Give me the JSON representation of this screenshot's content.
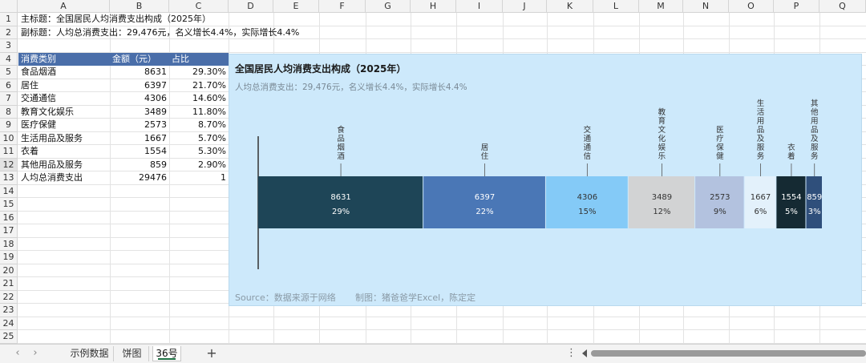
{
  "columns": [
    "A",
    "B",
    "C",
    "D",
    "E",
    "F",
    "G",
    "H",
    "I",
    "J",
    "K",
    "L",
    "M",
    "N",
    "O",
    "P",
    "Q"
  ],
  "rows": [
    "1",
    "2",
    "3",
    "4",
    "5",
    "6",
    "7",
    "8",
    "9",
    "10",
    "11",
    "12",
    "13",
    "14",
    "15",
    "16",
    "17",
    "18",
    "19",
    "20",
    "21",
    "22",
    "23",
    "24",
    "25"
  ],
  "selected_row": "12",
  "cells": {
    "a1": "主标题：全国居民人均消费支出构成（2025年）",
    "a2": "副标题：人均总消费支出：29,476元，名义增长4.4%，实际增长4.4%",
    "header": {
      "category": "消费类别",
      "amount": "金额（元）",
      "share": "占比"
    },
    "table": [
      {
        "category": "食品烟酒",
        "amount": "8631",
        "share": "29.30%"
      },
      {
        "category": "居住",
        "amount": "6397",
        "share": "21.70%"
      },
      {
        "category": "交通通信",
        "amount": "4306",
        "share": "14.60%"
      },
      {
        "category": "教育文化娱乐",
        "amount": "3489",
        "share": "11.80%"
      },
      {
        "category": "医疗保健",
        "amount": "2573",
        "share": "8.70%"
      },
      {
        "category": "生活用品及服务",
        "amount": "1667",
        "share": "5.70%"
      },
      {
        "category": "衣着",
        "amount": "1554",
        "share": "5.30%"
      },
      {
        "category": "其他用品及服务",
        "amount": "859",
        "share": "2.90%"
      }
    ],
    "total": {
      "category": "人均总消费支出",
      "amount": "29476",
      "share": "1"
    }
  },
  "chart_data": {
    "type": "bar",
    "orientation": "horizontal-stacked-100",
    "title": "全国居民人均消费支出构成（2025年）",
    "subtitle": "人均总消费支出：29,476元，名义增长4.4%，实际增长4.4%",
    "footer_source": "Source：数据来源于网络",
    "footer_credit": "制图：猪爸爸学Excel，陈定定",
    "total": 29476,
    "segments": [
      {
        "name": "食品烟酒",
        "value": 8631,
        "label": "8631",
        "pct": "29%",
        "color": "#1e4557"
      },
      {
        "name": "居住",
        "value": 6397,
        "label": "6397",
        "pct": "22%",
        "color": "#4a77b6"
      },
      {
        "name": "交通通信",
        "value": 4306,
        "label": "4306",
        "pct": "15%",
        "color": "#84caf7"
      },
      {
        "name": "教育文化娱乐",
        "value": 3489,
        "label": "3489",
        "pct": "12%",
        "color": "#d2d3d4"
      },
      {
        "name": "医疗保健",
        "value": 2573,
        "label": "2573",
        "pct": "9%",
        "color": "#b3c2df"
      },
      {
        "name": "生活用品及服务",
        "value": 1667,
        "label": "1667",
        "pct": "6%",
        "color": "#e3f1fb"
      },
      {
        "name": "衣着",
        "value": 1554,
        "label": "1554",
        "pct": "5%",
        "color": "#152a33"
      },
      {
        "name": "其他用品及服务",
        "value": 859,
        "label": "859",
        "pct": "3%",
        "color": "#2f4f7b"
      }
    ],
    "label_text_dark": "#333333",
    "label_text_light": "#ffffff"
  },
  "tabs": [
    {
      "label": "示例数据",
      "active": false
    },
    {
      "label": "饼图",
      "active": false
    },
    {
      "label": "36号",
      "active": true
    }
  ],
  "tabbar": {
    "add": "+",
    "more": "⋮",
    "prev": "‹",
    "next": "›"
  }
}
